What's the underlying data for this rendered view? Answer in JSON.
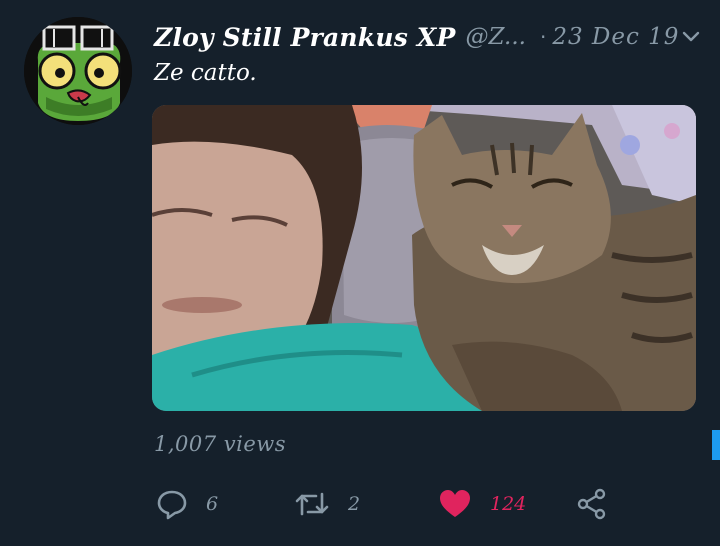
{
  "tweet": {
    "display_name": "Zloy Still Prankus XP",
    "handle": "@Z...",
    "separator": "·",
    "date": "23 Dec 19",
    "text": "Ze catto.",
    "views": "1,007 views",
    "avatar_icon": "green-cartoon-goggles-avatar",
    "media_description_icon": "photo-person-with-cat"
  },
  "actions": {
    "reply_count": "6",
    "retweet_count": "2",
    "like_count": "124",
    "liked": true
  },
  "colors": {
    "background": "#15202b",
    "secondary_text": "#8899a6",
    "like": "#e0245e",
    "accent": "#1d9bf0"
  }
}
